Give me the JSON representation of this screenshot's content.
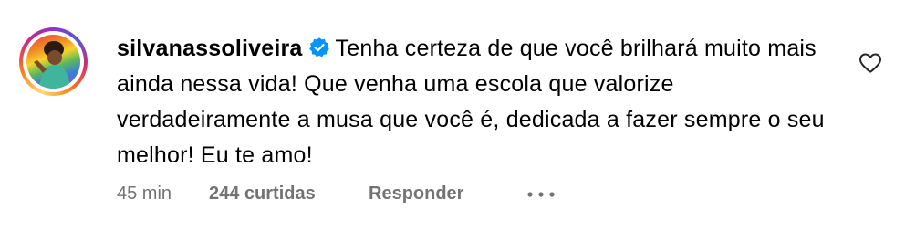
{
  "comment": {
    "username": "silvanassoliveira",
    "verified": true,
    "text": "Tenha certeza de que você brilhará muito mais ainda nessa vida! Que venha uma escola que valorize verdadeiramente a musa que você é, dedicada a fazer sempre o seu melhor! Eu te amo!",
    "time": "45 min",
    "likes": "244 curtidas",
    "reply_label": "Responder"
  },
  "icons": {
    "verified": "verified-badge-icon",
    "like": "heart-outline-icon",
    "more": "ellipsis-icon"
  },
  "colors": {
    "verified_blue": "#0095f6",
    "meta_gray": "#737373",
    "text": "#000000"
  }
}
